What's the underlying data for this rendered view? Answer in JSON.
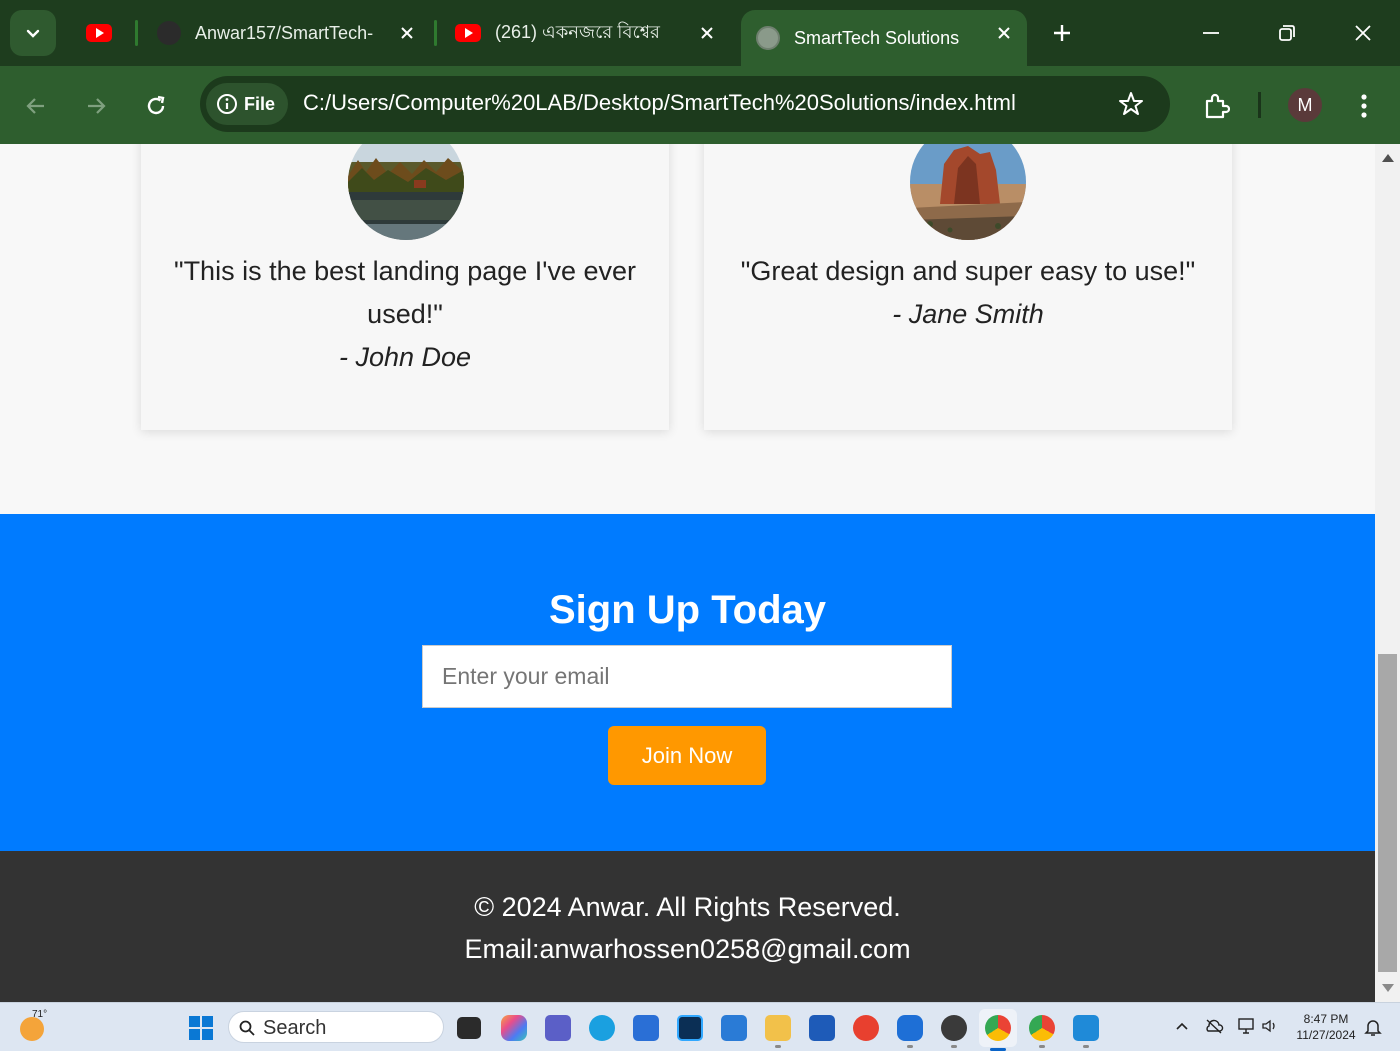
{
  "browser": {
    "tabs": [
      {
        "title": "",
        "icon": "youtube-icon"
      },
      {
        "title": "Anwar157/SmartTech-",
        "icon": "github-icon"
      },
      {
        "title": "(261) একনজরে বিশ্বের",
        "icon": "youtube-icon"
      },
      {
        "title": "SmartTech Solutions",
        "icon": "globe-icon",
        "active": true
      }
    ],
    "file_chip": "File",
    "url": "C:/Users/Computer%20LAB/Desktop/SmartTech%20Solutions/index.html",
    "profile_initial": "M"
  },
  "testimonials": [
    {
      "quote": "\"This is the best landing page I've ever used!\"",
      "author": "- John Doe"
    },
    {
      "quote": "\"Great design and super easy to use!\"",
      "author": "- Jane Smith"
    }
  ],
  "signup": {
    "heading": "Sign Up Today",
    "email_placeholder": "Enter your email",
    "button_label": "Join Now"
  },
  "footer": {
    "copyright": "© 2024 Anwar. All Rights Reserved.",
    "email_line": "Email:anwarhossen0258@gmail.com"
  },
  "taskbar": {
    "weather_temp": "71°",
    "search_label": "Search",
    "time": "8:47 PM",
    "date": "11/27/2024"
  },
  "colors": {
    "signup_bg": "#007bff",
    "button_bg": "#ff9800",
    "footer_bg": "#333333",
    "chrome_dark": "#1e3d1e",
    "chrome_toolbar": "#2e5e2e"
  }
}
